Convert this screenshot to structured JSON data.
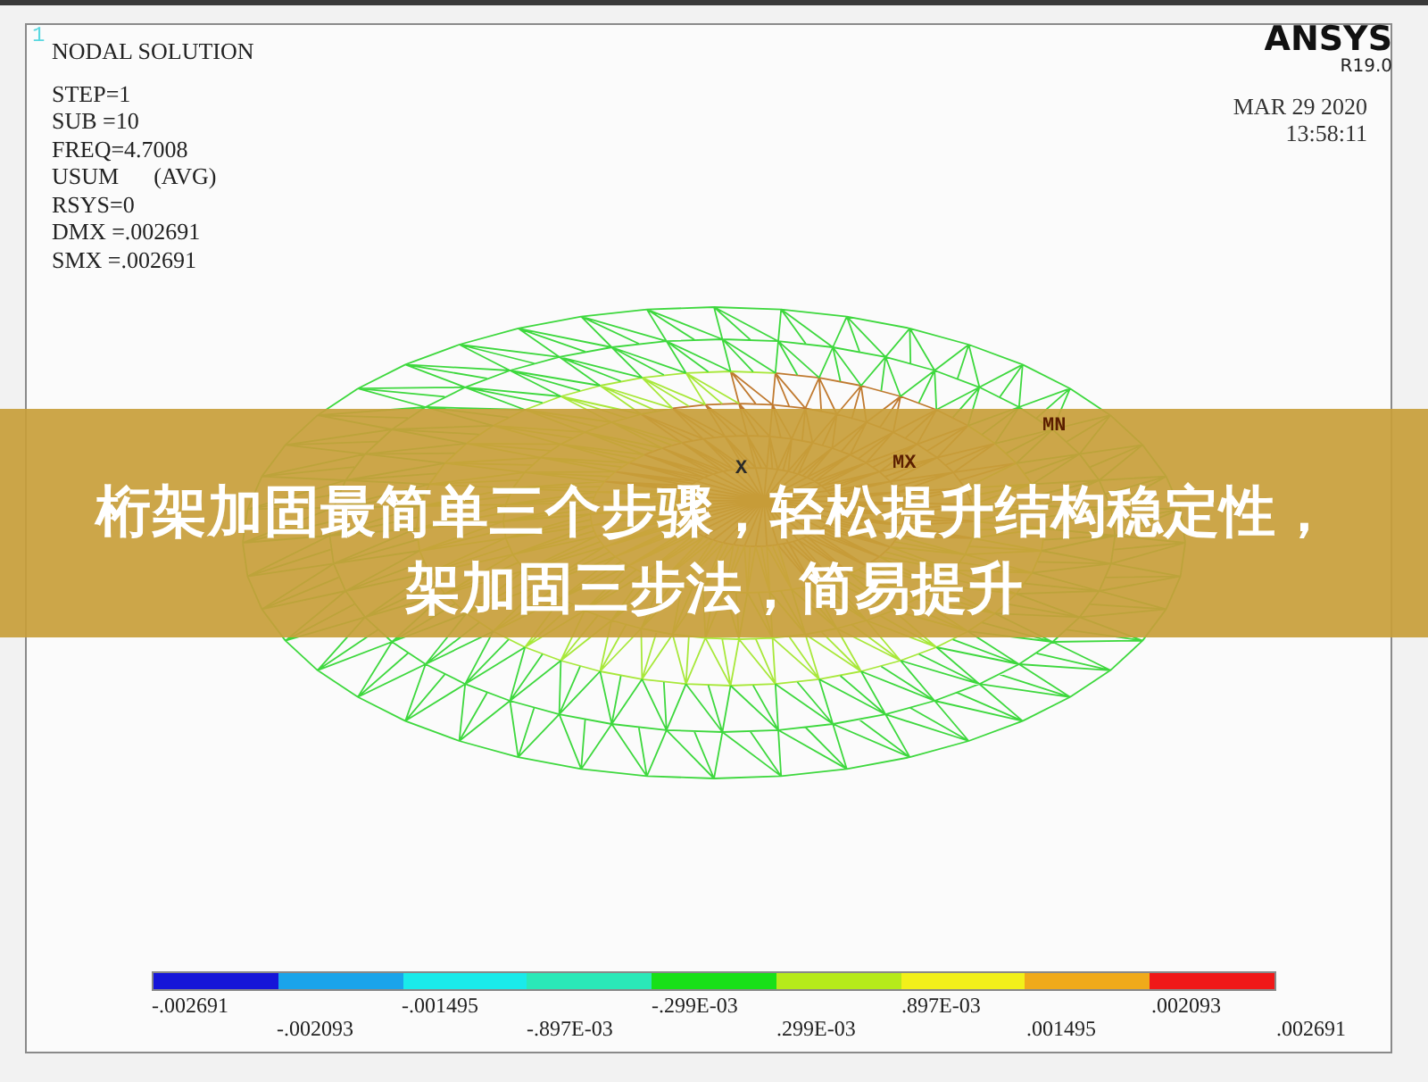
{
  "viewport_number": "1",
  "header": {
    "title": "NODAL SOLUTION",
    "lines": [
      "STEP=1",
      "SUB =10",
      "FREQ=4.7008",
      "USUM      (AVG)",
      "RSYS=0",
      "DMX =.002691",
      "SMX =.002691"
    ]
  },
  "brand": {
    "logo": "ANSYS",
    "version": "R19.0",
    "date": "MAR 29 2020",
    "time": "13:58:11"
  },
  "plot": {
    "markers": [
      {
        "label": "MN"
      },
      {
        "label": "MX"
      },
      {
        "label": "X"
      }
    ]
  },
  "legend": {
    "segments": [
      {
        "color": "#1616d8"
      },
      {
        "color": "#1aa4ea"
      },
      {
        "color": "#1aeaea"
      },
      {
        "color": "#2ae8b8"
      },
      {
        "color": "#18e018"
      },
      {
        "color": "#b6ea1a"
      },
      {
        "color": "#f2f01a"
      },
      {
        "color": "#f0aa1a"
      },
      {
        "color": "#f01818"
      }
    ],
    "labels": [
      "-.002691",
      "-.002093",
      "-.001495",
      "-.897E-03",
      "-.299E-03",
      ".299E-03",
      ".897E-03",
      ".001495",
      ".002093",
      ".002691"
    ]
  },
  "banner": {
    "text": "桁架加固最简单三个步骤，轻松提升结构稳定性，架加固三步法，简易提升"
  }
}
